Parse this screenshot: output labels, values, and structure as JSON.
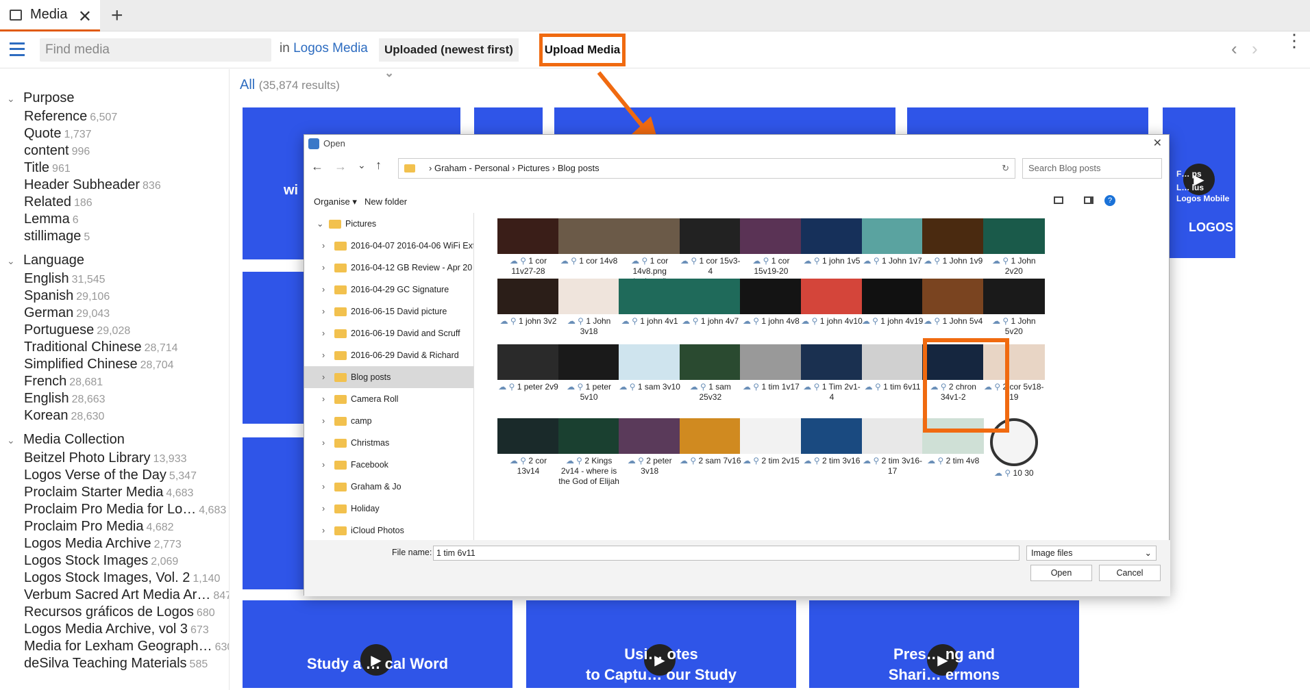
{
  "tab": {
    "title": "Media",
    "close": "✕",
    "new": "+"
  },
  "toolbar": {
    "search_placeholder": "Find media",
    "in_prefix": "in",
    "in_target": "Logos Media",
    "sort": "Uploaded (newest first)",
    "upload": "Upload Media"
  },
  "sidebar": {
    "purpose": {
      "title": "Purpose",
      "items": [
        [
          "Reference",
          "6,507"
        ],
        [
          "Quote",
          "1,737"
        ],
        [
          "content",
          "996"
        ],
        [
          "Title",
          "961"
        ],
        [
          "Header Subheader",
          "836"
        ],
        [
          "Related",
          "186"
        ],
        [
          "Lemma",
          "6"
        ],
        [
          "stillimage",
          "5"
        ]
      ]
    },
    "language": {
      "title": "Language",
      "items": [
        [
          "English",
          "31,545"
        ],
        [
          "Spanish",
          "29,106"
        ],
        [
          "German",
          "29,043"
        ],
        [
          "Portuguese",
          "29,028"
        ],
        [
          "Traditional Chinese",
          "28,714"
        ],
        [
          "Simplified Chinese",
          "28,704"
        ],
        [
          "French",
          "28,681"
        ],
        [
          "English",
          "28,663"
        ],
        [
          "Korean",
          "28,630"
        ]
      ]
    },
    "collection": {
      "title": "Media Collection",
      "items": [
        [
          "Beitzel Photo Library",
          "13,933"
        ],
        [
          "Logos Verse of the Day",
          "5,347"
        ],
        [
          "Proclaim Starter Media",
          "4,683"
        ],
        [
          "Proclaim Pro Media for Lo…",
          "4,683"
        ],
        [
          "Proclaim Pro Media",
          "4,682"
        ],
        [
          "Logos Media Archive",
          "2,773"
        ],
        [
          "Logos Stock Images",
          "2,069"
        ],
        [
          "Logos Stock Images, Vol. 2",
          "1,140"
        ],
        [
          "Verbum Sacred Art Media Ar…",
          "847"
        ],
        [
          "Recursos gráficos de Logos",
          "680"
        ],
        [
          "Logos Media Archive, vol 3",
          "673"
        ],
        [
          "Media for Lexham Geograph…",
          "630"
        ],
        [
          "deSilva Teaching Materials",
          "585"
        ]
      ]
    }
  },
  "results": {
    "label": "All",
    "count": "(35,874 results)"
  },
  "tiles": {
    "t1": "wi",
    "t2": "F… ps",
    "t2b": "L… lus",
    "t2c": "Logos Mobile",
    "t2d": "LOGOS",
    "b1": "Study a … cal Word",
    "b2": "Usi… otes",
    "b2b": "to Captu… our Study",
    "b3": "Pres… ng and",
    "b3b": "Shari… ermons"
  },
  "dialog": {
    "title": "Open",
    "path": [
      "Graham - Personal",
      "Pictures",
      "Blog posts"
    ],
    "search_placeholder": "Search Blog posts",
    "organise": "Organise ▾",
    "new_folder": "New folder",
    "tree": [
      "Pictures",
      "2016-04-07 2016-04-06 WiFi Ext",
      "2016-04-12 GB Review - Apr 20",
      "2016-04-29 GC Signature",
      "2016-06-15 David picture",
      "2016-06-19 David and Scruff",
      "2016-06-29 David & Richard",
      "Blog posts",
      "Camera Roll",
      "camp",
      "Christmas",
      "Facebook",
      "Graham & Jo",
      "Holiday",
      "iCloud Photos"
    ],
    "thumbs": [
      [
        "1 cor 11v27-28",
        "#3a1e18"
      ],
      [
        "1 cor 14v8",
        "#6b5a48"
      ],
      [
        "1 cor 14v8.png (reduced)",
        "#6b5a48"
      ],
      [
        "1 cor 15v3-4",
        "#222"
      ],
      [
        "1 cor 15v19-20",
        "#5a3355"
      ],
      [
        "1 john 1v5",
        "#16305a"
      ],
      [
        "1 John 1v7",
        "#5aa3a0"
      ],
      [
        "1 John 1v9",
        "#4a2a10"
      ],
      [
        "1 John 2v20",
        "#1a5a4a"
      ],
      [
        "1 john 3v2",
        "#2b1e18"
      ],
      [
        "1 John 3v18",
        "#efe4dc"
      ],
      [
        "1 john 4v1",
        "#1f6a5a"
      ],
      [
        "1 john 4v7",
        "#1f6a5a"
      ],
      [
        "1 john 4v8",
        "#141414"
      ],
      [
        "1 john 4v10",
        "#d4453a"
      ],
      [
        "1 john 4v19",
        "#111"
      ],
      [
        "1 John 5v4",
        "#7a4420"
      ],
      [
        "1 John 5v20",
        "#1a1a1a"
      ],
      [
        "1 peter 2v9",
        "#2a2a2a"
      ],
      [
        "1 peter 5v10",
        "#1a1a1a"
      ],
      [
        "1 sam 3v10",
        "#cfe4ee"
      ],
      [
        "1 sam 25v32",
        "#2a4a30"
      ],
      [
        "1 tim 1v17",
        "#999"
      ],
      [
        "1 Tim 2v1-4",
        "#1a3050"
      ],
      [
        "1 tim 6v11",
        "#d0d0d0"
      ],
      [
        "2 chron 34v1-2",
        "#15263f"
      ],
      [
        "2 cor 5v18-19",
        "#e8d5c5"
      ],
      [
        "2 cor 13v14",
        "#1a2a2a"
      ],
      [
        "2 Kings 2v14 - where is the God of Elijah",
        "#1a4030"
      ],
      [
        "2 peter 3v18",
        "#5a3a5a"
      ],
      [
        "2 sam 7v16",
        "#d08a20"
      ],
      [
        "2 tim 2v15",
        "#f2f2f2"
      ],
      [
        "2 tim 3v16",
        "#1a4a80"
      ],
      [
        "2 tim 3v16-17",
        "#e8e8e8"
      ],
      [
        "2 tim 4v8",
        "#cfe0d6"
      ],
      [
        "10 30",
        "#f4f4f4"
      ]
    ],
    "file_name_label": "File name:",
    "file_name": "1 tim 6v11",
    "file_type": "Image files",
    "open": "Open",
    "cancel": "Cancel"
  },
  "colors": {
    "accent": "#f06a10",
    "link": "#2d6cc0",
    "tile": "#2f55e8"
  }
}
